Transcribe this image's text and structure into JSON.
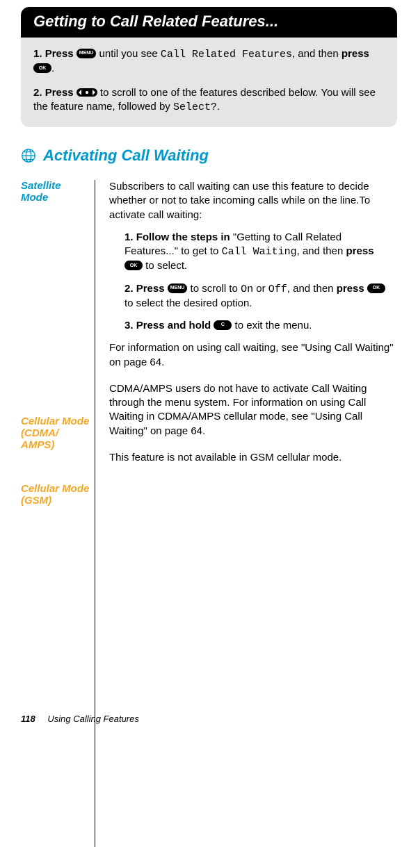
{
  "header": {
    "title": "Getting to Call Related Features..."
  },
  "greySteps": [
    {
      "numLabel": "1.",
      "bold1": "Press ",
      "btn1": "MENU",
      "mid1": " until you see ",
      "lcd1": "Call Related Features",
      "mid2": ", and then ",
      "bold2": "press ",
      "btn2": "OK",
      "tail": "."
    },
    {
      "numLabel": "2.",
      "bold1": "Press ",
      "arrow": true,
      "mid1": " to scroll to one of the features described below. You will see the feature name, followed by ",
      "lcd1": "Select?",
      "tail": "."
    }
  ],
  "section": {
    "title": "Activating Call Waiting"
  },
  "rows": [
    {
      "label": "Satellite Mode",
      "color": "blue",
      "intro": "Subscribers to call waiting can use this feature to decide whether or not to take incoming calls while on the line.To activate call waiting:",
      "steps": [
        {
          "num": "1.",
          "bold1": "Follow the steps in ",
          "plain1": "\"Getting to Call Related Features...\" to get to ",
          "lcd1": "Call Waiting",
          "plain2": ", and then ",
          "bold2": "press ",
          "btn1": "OK",
          "tail": " to select."
        },
        {
          "num": "2.",
          "bold1": "Press ",
          "btn1": "MENU",
          "plain1": " to scroll to ",
          "lcd1": "On",
          "plain2": " or ",
          "lcd2": "Off",
          "plain3": ", and then ",
          "bold2": "press ",
          "btn2": "OK",
          "tail": " to select the desired option."
        },
        {
          "num": "3.",
          "bold1": "Press and hold ",
          "btn1": "C",
          "tail": " to exit the menu."
        }
      ],
      "outro": "For information on using call waiting, see \"Using Call Waiting\" on page 64."
    },
    {
      "label": "Cellular Mode (CDMA/ AMPS)",
      "color": "orange",
      "body": "CDMA/AMPS users do not have to activate Call Waiting through the menu system. For information on using Call Waiting in CDMA/AMPS cellular mode, see \"Using Call Waiting\" on page 64."
    },
    {
      "label": "Cellular Mode (GSM)",
      "color": "orange",
      "body": "This feature is not available in GSM cellular mode."
    }
  ],
  "footer": {
    "page": "118",
    "chapter": "Using Calling Features"
  }
}
